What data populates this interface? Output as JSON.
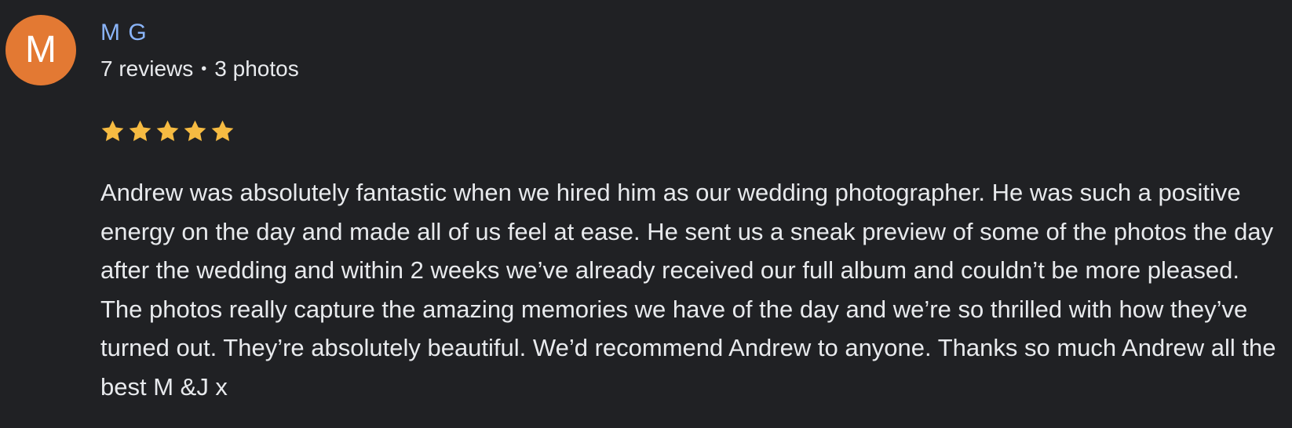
{
  "author": {
    "initial": "M",
    "avatar_color": "#e37933",
    "name": "M G",
    "name_color": "#8ab4f8",
    "reviews": "7 reviews",
    "separator": "•",
    "photos": "3 photos"
  },
  "rating": {
    "stars": 5,
    "max": 5,
    "star_color": "#f6bb42"
  },
  "review": {
    "text": "Andrew was absolutely fantastic when we hired him as our wedding photographer. He was such a positive energy on the day and made all of us feel at ease. He sent us a sneak preview of some of the photos the day after the wedding and within 2 weeks we’ve already received our full album and couldn’t be more pleased. The photos really capture the amazing memories we have of the day and we’re so thrilled with how they’ve turned out. They’re absolutely beautiful. We’d recommend Andrew to anyone. Thanks so much Andrew all the best M &J x"
  },
  "theme": {
    "background": "#202124",
    "text_color": "#e8eaed"
  }
}
